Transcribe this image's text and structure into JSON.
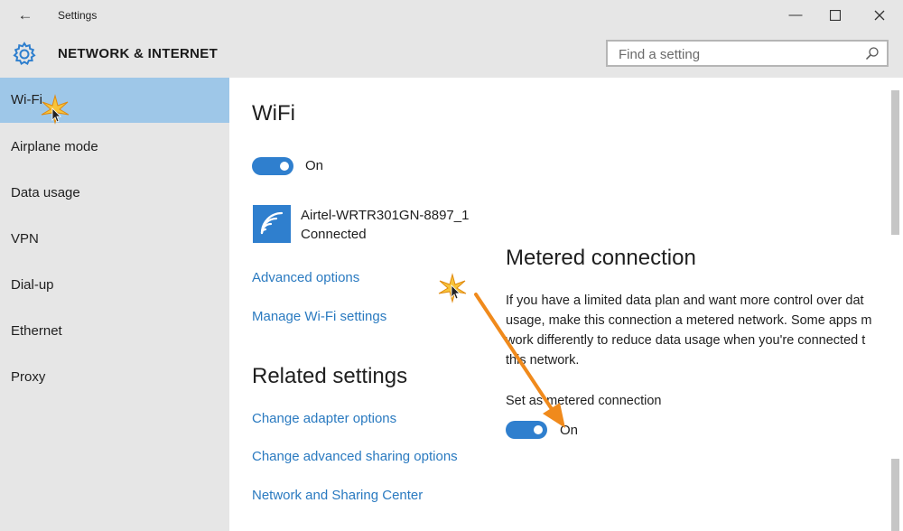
{
  "window": {
    "title": "Settings",
    "back_icon": "back-arrow-icon",
    "controls": [
      "minimize",
      "maximize",
      "close"
    ]
  },
  "header": {
    "section_title": "NETWORK & INTERNET",
    "search_placeholder": "Find a setting"
  },
  "sidebar": {
    "items": [
      {
        "label": "Wi-Fi",
        "active": true
      },
      {
        "label": "Airplane mode"
      },
      {
        "label": "Data usage"
      },
      {
        "label": "VPN"
      },
      {
        "label": "Dial-up"
      },
      {
        "label": "Ethernet"
      },
      {
        "label": "Proxy"
      }
    ]
  },
  "wifi": {
    "heading": "WiFi",
    "toggle_state": "On",
    "network_name": "Airtel-WRTR301GN-8897_1",
    "network_status": "Connected",
    "advanced_options": "Advanced options",
    "manage_wifi": "Manage Wi-Fi settings"
  },
  "related": {
    "heading": "Related settings",
    "links": [
      "Change adapter options",
      "Change advanced sharing options",
      "Network and Sharing Center"
    ]
  },
  "metered": {
    "heading": "Metered connection",
    "description_lines": [
      "If you have a limited data plan and want more control over dat",
      "usage, make this connection a metered network. Some apps m",
      "work differently to reduce data usage when you're connected t",
      "this network."
    ],
    "set_label": "Set as metered connection",
    "toggle_state": "On"
  },
  "colors": {
    "accent": "#2f7fce",
    "link": "#2a7ac0",
    "sidebar_bg": "#e6e6e6",
    "active_bg": "#9ec7e8",
    "annotation_arrow": "#f08a1c"
  }
}
